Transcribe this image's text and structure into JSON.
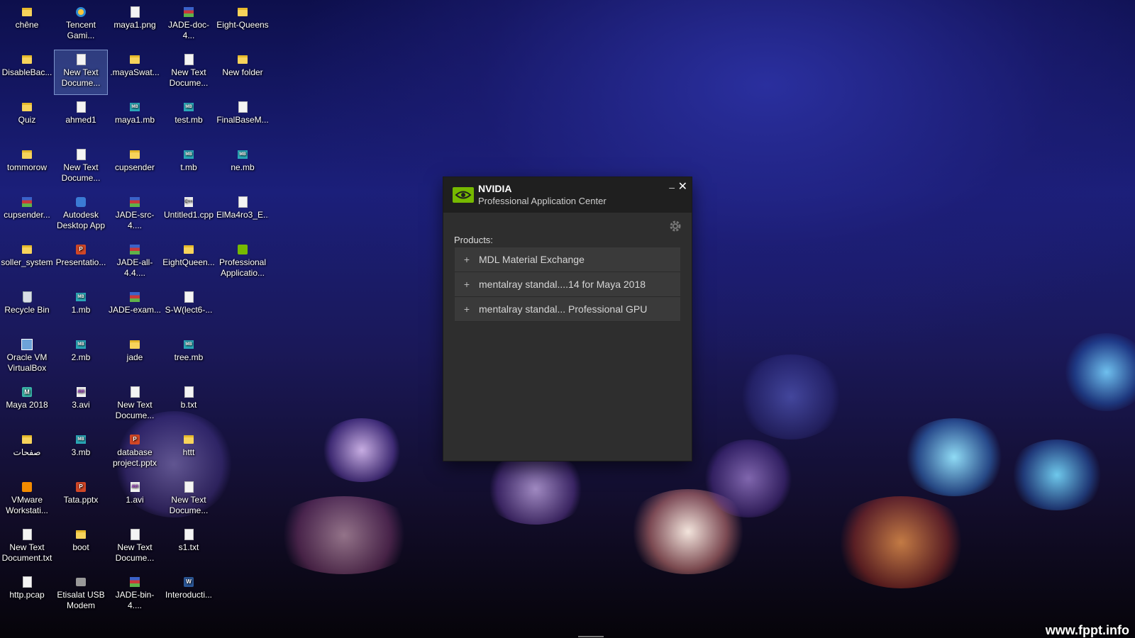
{
  "desktop": {
    "watermark": "www.fppt.info",
    "icons": [
      {
        "label": "chêne",
        "icon": "folder-icon"
      },
      {
        "label": "Tencent Gami...",
        "icon": "tencent-icon"
      },
      {
        "label": "maya1.png",
        "icon": "image-file-icon"
      },
      {
        "label": "JADE-doc-4...",
        "icon": "archive-icon"
      },
      {
        "label": "Eight-Queens",
        "icon": "folder-icon"
      },
      {
        "label": "DisableBac...",
        "icon": "folder-icon"
      },
      {
        "label": "New Text Docume...",
        "icon": "text-file-icon"
      },
      {
        "label": ".mayaSwat...",
        "icon": "folder-icon"
      },
      {
        "label": "New Text Docume...",
        "icon": "text-file-icon"
      },
      {
        "label": "New folder",
        "icon": "folder-icon"
      },
      {
        "label": "Quiz",
        "icon": "folder-icon"
      },
      {
        "label": "ahmed1",
        "icon": "file-icon"
      },
      {
        "label": "maya1.mb",
        "icon": "maya-scene-icon"
      },
      {
        "label": "test.mb",
        "icon": "maya-scene-icon"
      },
      {
        "label": "FinalBaseM...",
        "icon": "file-icon"
      },
      {
        "label": "tommorow",
        "icon": "folder-icon"
      },
      {
        "label": "New Text Docume...",
        "icon": "text-file-icon"
      },
      {
        "label": "cupsender",
        "icon": "folder-icon"
      },
      {
        "label": "t.mb",
        "icon": "maya-scene-icon"
      },
      {
        "label": "ne.mb",
        "icon": "maya-scene-icon"
      },
      {
        "label": "cupsender...",
        "icon": "archive-icon"
      },
      {
        "label": "Autodesk Desktop App",
        "icon": "autodesk-icon"
      },
      {
        "label": "JADE-src-4....",
        "icon": "archive-icon"
      },
      {
        "label": "Untitled1.cpp",
        "icon": "cpp-file-icon"
      },
      {
        "label": "ElMa4ro3_E...",
        "icon": "file-icon"
      },
      {
        "label": "soller_system",
        "icon": "folder-icon"
      },
      {
        "label": "Presentatio...",
        "icon": "powerpoint-icon"
      },
      {
        "label": "JADE-all-4.4....",
        "icon": "archive-icon"
      },
      {
        "label": "EightQueen...",
        "icon": "folder-icon"
      },
      {
        "label": "Professional Applicatio...",
        "icon": "nvidia-app-icon"
      },
      {
        "label": "Recycle Bin",
        "icon": "recycle-bin-icon"
      },
      {
        "label": "1.mb",
        "icon": "maya-scene-icon"
      },
      {
        "label": "JADE-exam...",
        "icon": "archive-icon"
      },
      {
        "label": "S-W(lect6-...",
        "icon": "text-file-icon"
      },
      {
        "label": "",
        "icon": ""
      },
      {
        "label": "Oracle VM VirtualBox",
        "icon": "virtualbox-icon"
      },
      {
        "label": "2.mb",
        "icon": "maya-scene-icon"
      },
      {
        "label": "jade",
        "icon": "folder-icon"
      },
      {
        "label": "tree.mb",
        "icon": "maya-scene-icon"
      },
      {
        "label": "",
        "icon": ""
      },
      {
        "label": "Maya 2018",
        "icon": "maya-app-icon"
      },
      {
        "label": "3.avi",
        "icon": "video-file-icon"
      },
      {
        "label": "New Text Docume...",
        "icon": "text-file-icon"
      },
      {
        "label": "b.txt",
        "icon": "text-file-icon"
      },
      {
        "label": "",
        "icon": ""
      },
      {
        "label": "صفحات",
        "icon": "folder-icon"
      },
      {
        "label": "3.mb",
        "icon": "maya-scene-icon"
      },
      {
        "label": "database project.pptx",
        "icon": "powerpoint-icon"
      },
      {
        "label": "httt",
        "icon": "folder-icon"
      },
      {
        "label": "",
        "icon": ""
      },
      {
        "label": "VMware Workstati...",
        "icon": "vmware-icon"
      },
      {
        "label": "Tata.pptx",
        "icon": "powerpoint-icon"
      },
      {
        "label": "1.avi",
        "icon": "video-file-icon"
      },
      {
        "label": "New Text Docume...",
        "icon": "text-file-icon"
      },
      {
        "label": "",
        "icon": ""
      },
      {
        "label": "New Text Document.txt",
        "icon": "text-file-icon"
      },
      {
        "label": "boot",
        "icon": "folder-icon"
      },
      {
        "label": "New Text Docume...",
        "icon": "text-file-icon"
      },
      {
        "label": "s1.txt",
        "icon": "text-file-icon"
      },
      {
        "label": "",
        "icon": ""
      },
      {
        "label": "http.pcap",
        "icon": "pcap-file-icon"
      },
      {
        "label": "Etisalat USB Modem",
        "icon": "modem-icon"
      },
      {
        "label": "JADE-bin-4....",
        "icon": "archive-icon"
      },
      {
        "label": "Interoducti...",
        "icon": "word-icon"
      },
      {
        "label": "",
        "icon": ""
      }
    ],
    "selected_index": 6
  },
  "nvidia_window": {
    "brand": "NVIDIA",
    "subtitle": "Professional Application Center",
    "minimize_glyph": "–",
    "close_glyph": "✕",
    "products_label": "Products:",
    "products": [
      {
        "expand_glyph": "+",
        "name": "MDL Material Exchange"
      },
      {
        "expand_glyph": "+",
        "name": "mentalray standal....14 for Maya 2018"
      },
      {
        "expand_glyph": "+",
        "name": "mentalray standal... Professional GPU"
      }
    ],
    "accent_color": "#76b900"
  }
}
